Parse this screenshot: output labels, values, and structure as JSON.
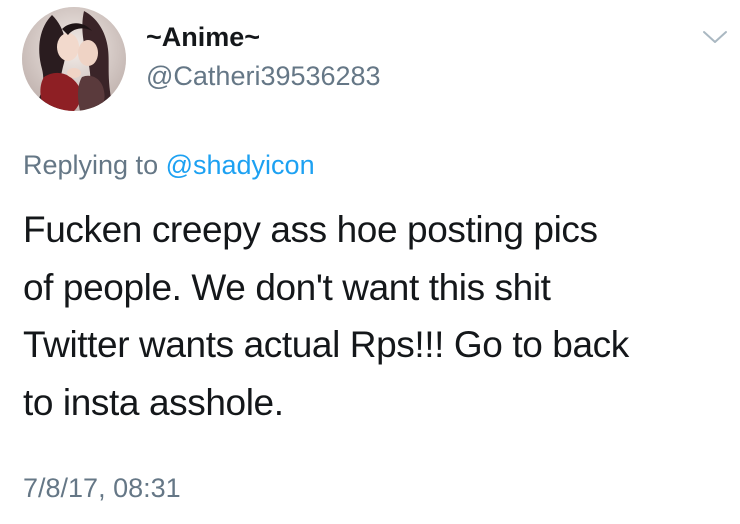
{
  "user": {
    "display_name": "~Anime~",
    "handle": "@Catheri39536283",
    "avatar_icon": "anime-avatar"
  },
  "menu": {
    "icon": "chevron-down-icon"
  },
  "reply": {
    "prefix": "Replying to ",
    "mention": "@shadyicon"
  },
  "tweet": {
    "lines": [
      "Fucken creepy ass hoe posting pics",
      "of people. We don't want this shit",
      "Twitter wants actual Rps!!! Go to back",
      "to insta asshole."
    ],
    "timestamp": "7/8/17, 08:31"
  },
  "colors": {
    "text_primary": "#14171a",
    "text_secondary": "#657786",
    "link": "#1da1f2",
    "background": "#ffffff"
  }
}
